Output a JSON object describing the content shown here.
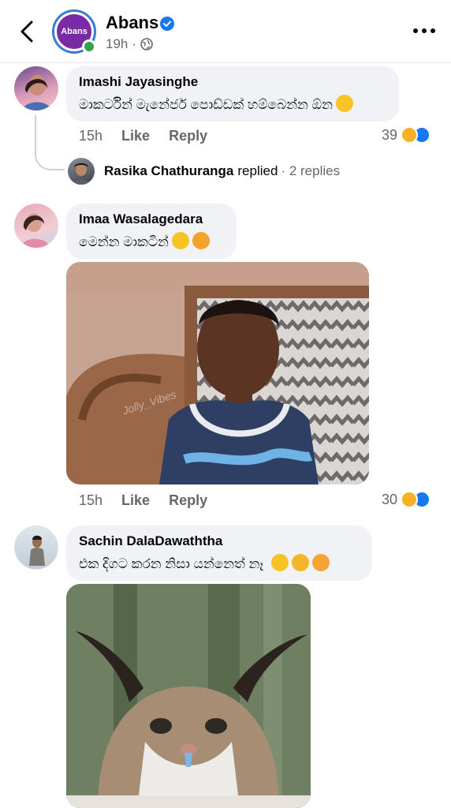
{
  "header": {
    "page_name": "Abans",
    "avatar_text": "Abans",
    "time": "19h",
    "separator": "·"
  },
  "comments": [
    {
      "author": "Imashi Jayasinghe",
      "text": "මාකර්ටින් මැනේජර් පොඩ්ඩක් හම්බෙන්න ඕන",
      "time": "15h",
      "like_label": "Like",
      "reply_label": "Reply",
      "reactions": "39",
      "replies": {
        "author": "Rasika Chathuranga",
        "verb": "replied",
        "count": "· 2 replies"
      }
    },
    {
      "author": "Imaa Wasalagedara",
      "text": "මෙන්න මාකටින්",
      "time": "15h",
      "like_label": "Like",
      "reply_label": "Reply",
      "reactions": "30",
      "image_watermark": "Jolly_Vibes"
    },
    {
      "author": "Sachin DalaDawaththa",
      "text": "එක දිගට කරන නිසා යන්නෙත් නෑ"
    }
  ],
  "colors": {
    "brand_purple": "#7b2aa6",
    "facebook_blue": "#1877f2",
    "bubble_bg": "#f0f2f5",
    "secondary_text": "#65676b",
    "online_green": "#31a24c"
  },
  "icons": [
    "back-arrow-icon",
    "verified-badge-icon",
    "globe-icon",
    "more-dots-icon",
    "haha-reaction-icon",
    "like-reaction-icon"
  ]
}
